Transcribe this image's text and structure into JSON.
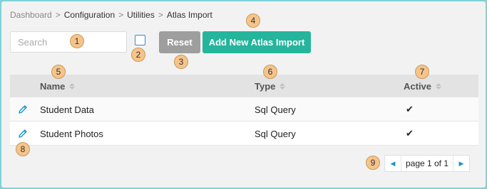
{
  "breadcrumb": {
    "items": [
      "Dashboard",
      "Configuration",
      "Utilities",
      "Atlas Import"
    ],
    "separator": ">"
  },
  "toolbar": {
    "search_placeholder": "Search",
    "reset_label": "Reset",
    "add_label": "Add New Atlas Import"
  },
  "table": {
    "columns": [
      "Name",
      "Type",
      "Active"
    ],
    "rows": [
      {
        "name": "Student Data",
        "type": "Sql Query",
        "active": "✔"
      },
      {
        "name": "Student Photos",
        "type": "Sql Query",
        "active": "✔"
      }
    ]
  },
  "pager": {
    "label": "page 1 of 1",
    "prev_icon": "caret-left-icon",
    "next_icon": "caret-right-icon"
  },
  "callouts": [
    "1",
    "2",
    "3",
    "4",
    "5",
    "6",
    "7",
    "8",
    "9"
  ],
  "colors": {
    "frame": "#7fd3d9",
    "accent": "#24b59c",
    "reset": "#9e9e9e",
    "badge": "#f6c48a",
    "link": "#1a96c8"
  }
}
